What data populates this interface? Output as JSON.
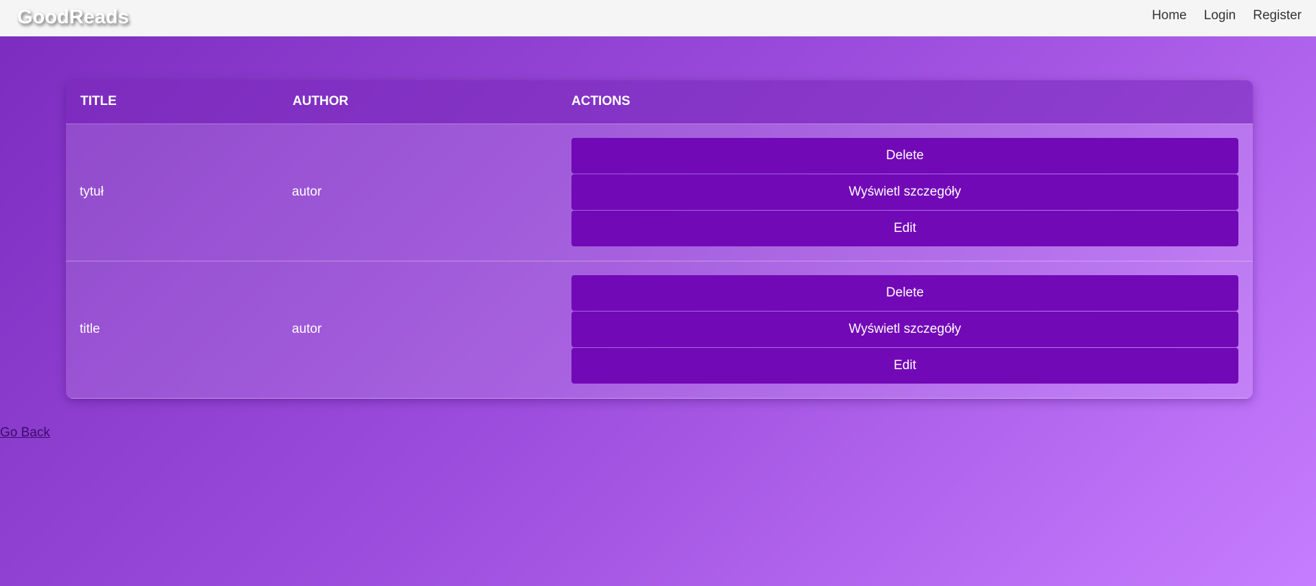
{
  "navbar": {
    "logo": "GoodReads",
    "links": [
      "Home",
      "Login",
      "Register"
    ]
  },
  "table": {
    "headers": [
      "TITLE",
      "AUTHOR",
      "ACTIONS"
    ],
    "rows": [
      {
        "title": "tytuł",
        "author": "autor",
        "actions": [
          "Delete",
          "Wyświetl szczegóły",
          "Edit"
        ]
      },
      {
        "title": "title",
        "author": "autor",
        "actions": [
          "Delete",
          "Wyświetl szczegóły",
          "Edit"
        ]
      }
    ]
  },
  "footer": {
    "go_back": "Go Back"
  },
  "colors": {
    "navbar_bg": "#f5f5f5",
    "button_bg": "#7209b7",
    "gradient_start": "#7b2cbf",
    "gradient_end": "#c77dff"
  }
}
